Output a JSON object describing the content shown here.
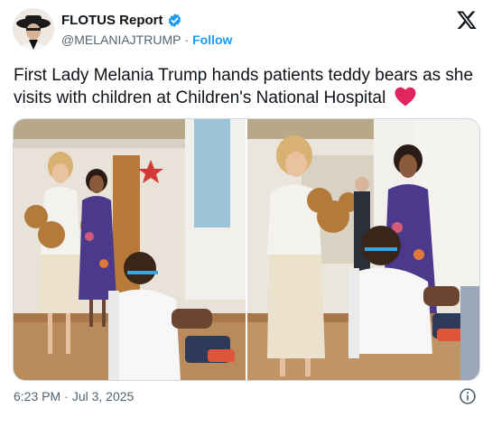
{
  "account": {
    "display_name": "FLOTUS Report",
    "handle": "@MELANIAJTRUMP",
    "separator": "·",
    "follow_label": "Follow"
  },
  "post": {
    "text": "First Lady Melania Trump hands patients teddy bears as she visits with children at Children's National Hospital"
  },
  "media": {
    "photos": [
      {
        "name": "hospital-visit-photo-1"
      },
      {
        "name": "hospital-visit-photo-2"
      }
    ]
  },
  "footer": {
    "time": "6:23 PM",
    "separator": "·",
    "date": "Jul 3, 2025"
  },
  "icons": {
    "verified": "verified-badge-icon",
    "platform": "x-logo-icon",
    "emoji": "red-heart-emoji",
    "info": "info-icon"
  },
  "colors": {
    "accent": "#1d9bf0",
    "text": "#0f1419",
    "secondary": "#536471",
    "heart": "#e0245e"
  }
}
